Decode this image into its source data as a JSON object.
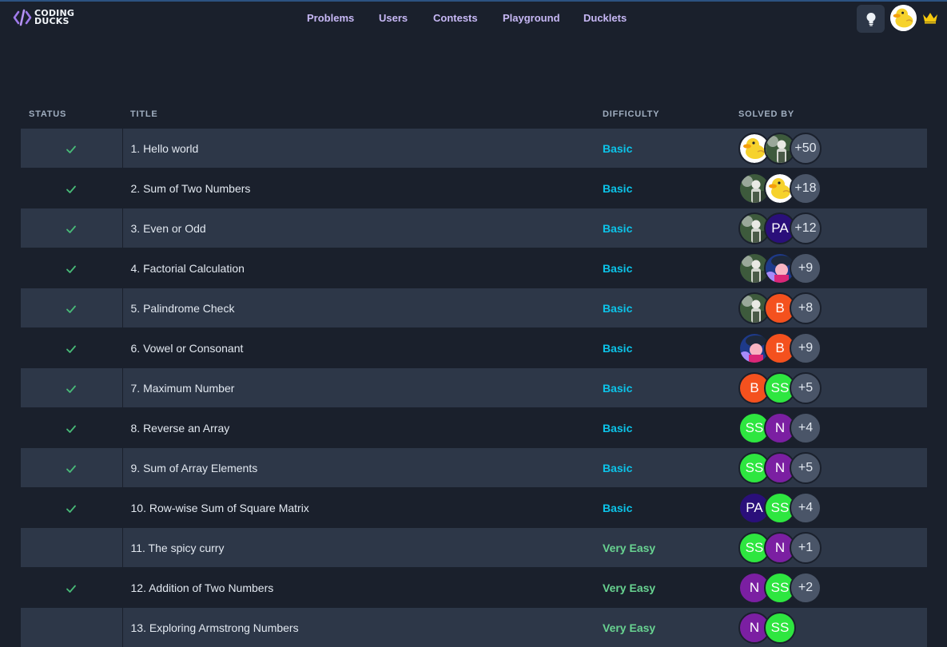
{
  "app": {
    "logo_line1": "CODING",
    "logo_line2": "DUCKS",
    "accent": "#805ad5"
  },
  "nav": {
    "items": [
      {
        "label": "Problems"
      },
      {
        "label": "Users"
      },
      {
        "label": "Contests"
      },
      {
        "label": "Playground"
      },
      {
        "label": "Ducklets"
      }
    ]
  },
  "header_icons": {
    "tips": "lightbulb-icon",
    "user": "duck-avatar-icon",
    "premium": "crown-icon"
  },
  "table": {
    "headers": {
      "status": "Status",
      "title": "Title",
      "difficulty": "Difficulty",
      "solved_by": "Solved by"
    },
    "rows": [
      {
        "solved": true,
        "title": "1. Hello world",
        "difficulty": "Basic",
        "solvers": [
          {
            "type": "duck"
          },
          {
            "type": "photo"
          }
        ],
        "more": "+50"
      },
      {
        "solved": true,
        "title": "2. Sum of Two Numbers",
        "difficulty": "Basic",
        "solvers": [
          {
            "type": "photo"
          },
          {
            "type": "duck"
          }
        ],
        "more": "+18"
      },
      {
        "solved": true,
        "title": "3. Even or Odd",
        "difficulty": "Basic",
        "solvers": [
          {
            "type": "photo"
          },
          {
            "type": "initials",
            "text": "PA",
            "color": "#2a0f7a"
          }
        ],
        "more": "+12"
      },
      {
        "solved": true,
        "title": "4. Factorial Calculation",
        "difficulty": "Basic",
        "solvers": [
          {
            "type": "photo"
          },
          {
            "type": "portrait"
          }
        ],
        "more": "+9"
      },
      {
        "solved": true,
        "title": "5. Palindrome Check",
        "difficulty": "Basic",
        "solvers": [
          {
            "type": "photo"
          },
          {
            "type": "initials",
            "text": "B",
            "color": "#f4511e"
          }
        ],
        "more": "+8"
      },
      {
        "solved": true,
        "title": "6. Vowel or Consonant",
        "difficulty": "Basic",
        "solvers": [
          {
            "type": "portrait"
          },
          {
            "type": "initials",
            "text": "B",
            "color": "#f4511e"
          }
        ],
        "more": "+9"
      },
      {
        "solved": true,
        "title": "7. Maximum Number",
        "difficulty": "Basic",
        "solvers": [
          {
            "type": "initials",
            "text": "B",
            "color": "#f4511e"
          },
          {
            "type": "initials",
            "text": "SS",
            "color": "#2ee640"
          }
        ],
        "more": "+5"
      },
      {
        "solved": true,
        "title": "8. Reverse an Array",
        "difficulty": "Basic",
        "solvers": [
          {
            "type": "initials",
            "text": "SS",
            "color": "#2ee640"
          },
          {
            "type": "initials",
            "text": "N",
            "color": "#7b1fa2"
          }
        ],
        "more": "+4"
      },
      {
        "solved": true,
        "title": "9. Sum of Array Elements",
        "difficulty": "Basic",
        "solvers": [
          {
            "type": "initials",
            "text": "SS",
            "color": "#2ee640"
          },
          {
            "type": "initials",
            "text": "N",
            "color": "#7b1fa2"
          }
        ],
        "more": "+5"
      },
      {
        "solved": true,
        "title": "10. Row-wise Sum of Square Matrix",
        "difficulty": "Basic",
        "solvers": [
          {
            "type": "initials",
            "text": "PA",
            "color": "#2a0f7a"
          },
          {
            "type": "initials",
            "text": "SS",
            "color": "#2ee640"
          }
        ],
        "more": "+4"
      },
      {
        "solved": false,
        "title": "11. The spicy curry",
        "difficulty": "Very Easy",
        "solvers": [
          {
            "type": "initials",
            "text": "SS",
            "color": "#2ee640"
          },
          {
            "type": "initials",
            "text": "N",
            "color": "#7b1fa2"
          }
        ],
        "more": "+1"
      },
      {
        "solved": true,
        "title": "12. Addition of Two Numbers",
        "difficulty": "Very Easy",
        "solvers": [
          {
            "type": "initials",
            "text": "N",
            "color": "#7b1fa2"
          },
          {
            "type": "initials",
            "text": "SS",
            "color": "#2ee640"
          }
        ],
        "more": "+2"
      },
      {
        "solved": false,
        "title": "13. Exploring Armstrong Numbers",
        "difficulty": "Very Easy",
        "solvers": [
          {
            "type": "initials",
            "text": "N",
            "color": "#7b1fa2"
          },
          {
            "type": "initials",
            "text": "SS",
            "color": "#2ee640"
          }
        ],
        "more": ""
      }
    ]
  }
}
